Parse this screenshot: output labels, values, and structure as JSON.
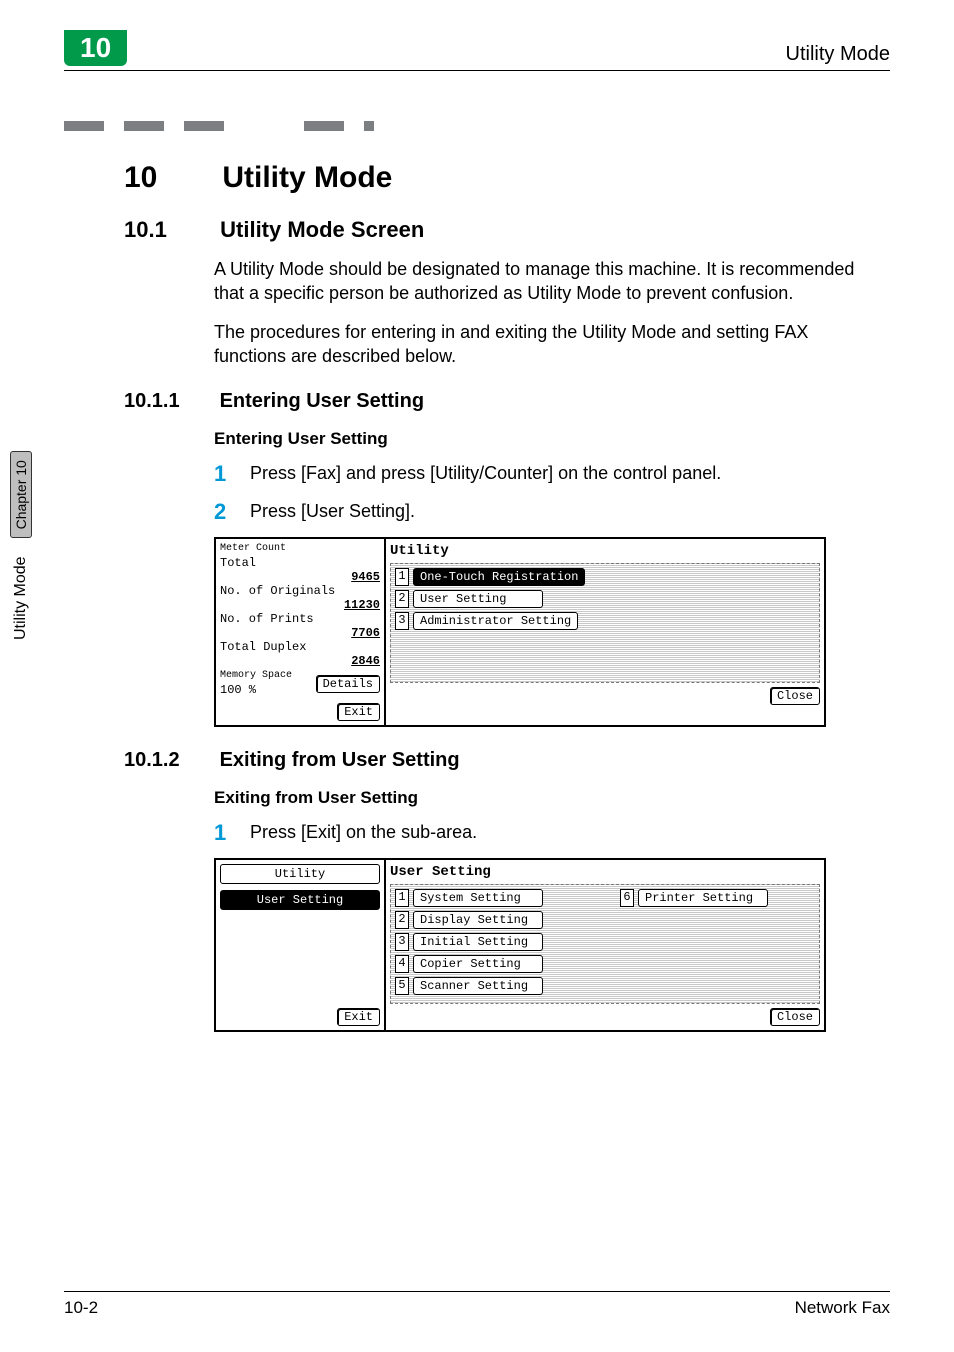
{
  "header": {
    "chapter_number": "10",
    "running_title": "Utility Mode"
  },
  "side": {
    "section_label": "Utility Mode",
    "chapter_tab": "Chapter 10"
  },
  "title": {
    "number": "10",
    "text": "Utility Mode"
  },
  "section_10_1": {
    "number": "10.1",
    "text": "Utility Mode Screen",
    "para1": "A Utility Mode should be designated to manage this machine. It is recommended that a specific person be authorized as Utility Mode to prevent confusion.",
    "para2": "The procedures for entering in and exiting the Utility Mode and setting FAX functions are described below."
  },
  "section_10_1_1": {
    "number": "10.1.1",
    "text": "Entering User Setting",
    "runhead": "Entering User Setting",
    "steps": [
      {
        "n": "1",
        "t": "Press [Fax] and press [Utility/Counter] on the control panel."
      },
      {
        "n": "2",
        "t": "Press [User Setting]."
      }
    ]
  },
  "figure1": {
    "left": {
      "title": "Meter Count",
      "rows": [
        {
          "label": "Total",
          "value": "9465"
        },
        {
          "label": "No. of Originals",
          "value": "11230"
        },
        {
          "label": "No. of Prints",
          "value": "7706"
        },
        {
          "label": "Total Duplex",
          "value": "2846"
        }
      ],
      "memory_label": "Memory Space",
      "memory_value": "100 %",
      "details_btn": "Details",
      "exit_btn": "Exit"
    },
    "right": {
      "header": "Utility",
      "items": [
        {
          "n": "1",
          "label": "One-Touch Registration",
          "selected": true
        },
        {
          "n": "2",
          "label": "User Setting",
          "selected": false
        },
        {
          "n": "3",
          "label": "Administrator Setting",
          "selected": false
        }
      ],
      "close_btn": "Close"
    }
  },
  "section_10_1_2": {
    "number": "10.1.2",
    "text": "Exiting from User Setting",
    "runhead": "Exiting from User Setting",
    "steps": [
      {
        "n": "1",
        "t": "Press [Exit] on the sub-area."
      }
    ]
  },
  "figure2": {
    "left": {
      "utility_tab": "Utility",
      "user_setting_tab": "User Setting",
      "exit_btn": "Exit"
    },
    "right": {
      "header": "User Setting",
      "col1": [
        {
          "n": "1",
          "label": "System Setting"
        },
        {
          "n": "2",
          "label": "Display Setting"
        },
        {
          "n": "3",
          "label": "Initial Setting"
        },
        {
          "n": "4",
          "label": "Copier Setting"
        },
        {
          "n": "5",
          "label": "Scanner Setting"
        }
      ],
      "col2": [
        {
          "n": "6",
          "label": "Printer Setting"
        }
      ],
      "close_btn": "Close"
    }
  },
  "footer": {
    "page": "10-2",
    "product": "Network Fax"
  }
}
